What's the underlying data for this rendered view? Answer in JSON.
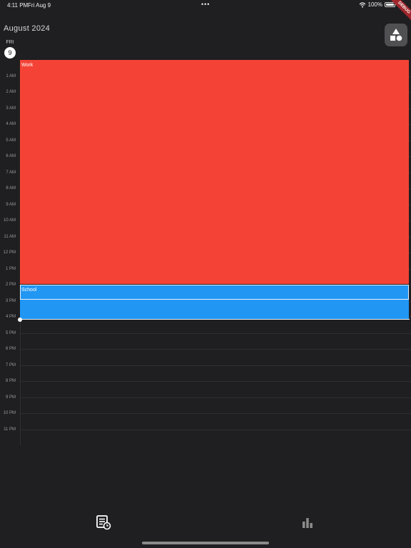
{
  "status_bar": {
    "time": "4:11 PM",
    "date": "Fri Aug 9",
    "dots": "•••",
    "battery": "100%"
  },
  "debug_ribbon": "DEBUG",
  "header": {
    "month_title": "August 2024"
  },
  "day": {
    "name": "FRI",
    "number": "9"
  },
  "hours": [
    "1 AM",
    "2 AM",
    "3 AM",
    "4 AM",
    "5 AM",
    "6 AM",
    "7 AM",
    "8 AM",
    "9 AM",
    "10 AM",
    "11 AM",
    "12 PM",
    "1 PM",
    "2 PM",
    "3 PM",
    "4 PM",
    "5 PM",
    "6 PM",
    "7 PM",
    "8 PM",
    "9 PM",
    "10 PM",
    "11 PM"
  ],
  "events": [
    {
      "title": "Work",
      "color": "#f44336"
    },
    {
      "title": "School",
      "color": "#2196f3"
    }
  ],
  "colors": {
    "background": "#1f1f21",
    "accent_red": "#f44336",
    "accent_blue": "#2196f3"
  },
  "icons": {
    "add_event": "shapes-icon",
    "timeline_tab": "list-clock-icon",
    "stats_tab": "bar-chart-icon"
  }
}
